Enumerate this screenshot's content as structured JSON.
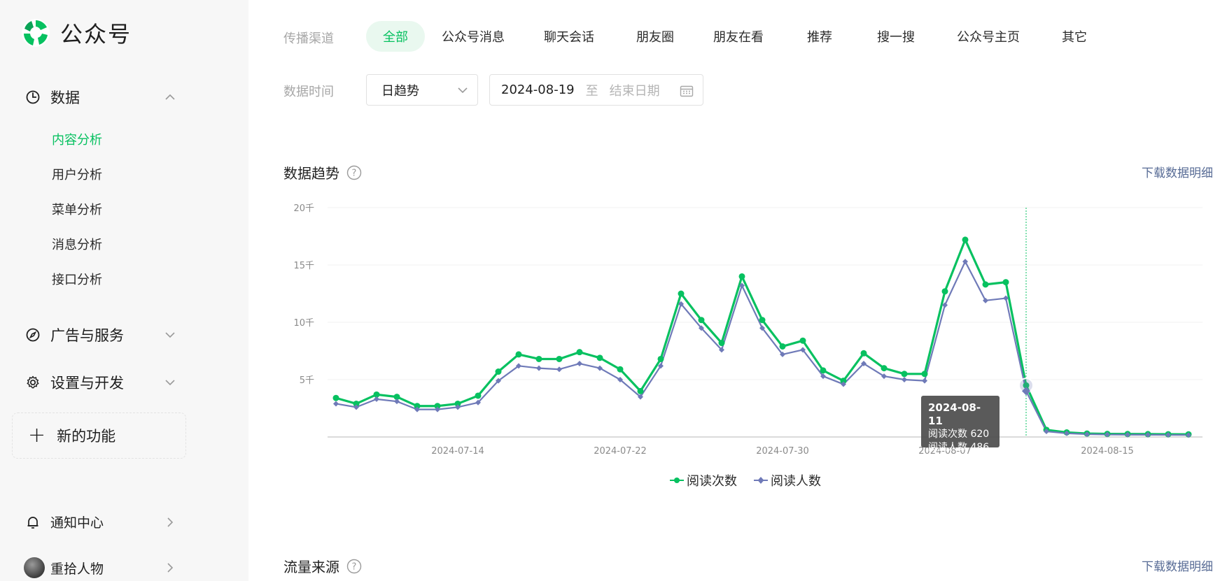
{
  "app": {
    "title": "公众号",
    "logo_icon": "wechat-official-account-logo-icon"
  },
  "sidebar": {
    "data_section": {
      "label": "数据",
      "icon": "pie-chart-icon"
    },
    "data_items": [
      {
        "label": "内容分析",
        "active": true
      },
      {
        "label": "用户分析",
        "active": false
      },
      {
        "label": "菜单分析",
        "active": false
      },
      {
        "label": "消息分析",
        "active": false
      },
      {
        "label": "接口分析",
        "active": false
      }
    ],
    "ads_section": {
      "label": "广告与服务",
      "icon": "compass-icon"
    },
    "settings_section": {
      "label": "设置与开发",
      "icon": "gear-icon"
    },
    "new_feature": {
      "label": "新的功能",
      "icon": "plus-icon"
    },
    "notification": {
      "label": "通知中心",
      "icon": "bell-icon"
    },
    "account": {
      "label": "重拾人物"
    }
  },
  "filters": {
    "channel_label": "传播渠道",
    "channels": [
      "全部",
      "公众号消息",
      "聊天会话",
      "朋友圈",
      "朋友在看",
      "推荐",
      "搜一搜",
      "公众号主页",
      "其它"
    ],
    "active_channel": "全部",
    "time_label": "数据时间",
    "trend_select": "日趋势",
    "start_date": "2024-08-19",
    "range_sep": "至",
    "end_placeholder": "结束日期"
  },
  "trend_section": {
    "title": "数据趋势",
    "download": "下载数据明细"
  },
  "traffic_section": {
    "title": "流量来源",
    "download": "下载数据明细"
  },
  "colors": {
    "accent": "#07c160",
    "series2": "#6f7ab8",
    "link": "#576b95"
  },
  "tooltip": {
    "date": "2024-08-11",
    "line1": "阅读次数 620",
    "line2": "阅读人数 486"
  },
  "chart_data": {
    "type": "line",
    "x_ticks": [
      "2024-07-14",
      "2024-07-22",
      "2024-07-30",
      "2024-08-07",
      "2024-08-15"
    ],
    "y_ticks": [
      "5千",
      "10千",
      "15千",
      "20千"
    ],
    "ylim": [
      0,
      20000
    ],
    "x_start": "2024-07-08",
    "x_end": "2024-08-19",
    "series": [
      {
        "name": "阅读次数",
        "color": "#07c160",
        "marker": "circle",
        "values": [
          3400,
          2900,
          3700,
          3500,
          2700,
          2700,
          2900,
          3600,
          5700,
          7200,
          6800,
          6800,
          7400,
          6900,
          5900,
          4000,
          6800,
          12500,
          10200,
          8200,
          14000,
          10200,
          7900,
          8400,
          5800,
          4900,
          7300,
          6000,
          5500,
          5500,
          12700,
          17200,
          13300,
          13500,
          4500,
          620,
          400,
          300,
          270,
          260,
          250,
          240,
          230
        ]
      },
      {
        "name": "阅读人数",
        "color": "#6f7ab8",
        "marker": "diamond",
        "values": [
          2900,
          2600,
          3300,
          3100,
          2400,
          2400,
          2600,
          3000,
          4900,
          6200,
          6000,
          5900,
          6400,
          6000,
          5000,
          3500,
          6200,
          11600,
          9500,
          7600,
          13200,
          9500,
          7200,
          7600,
          5300,
          4600,
          6400,
          5300,
          5000,
          4900,
          11500,
          15300,
          11900,
          12100,
          4000,
          486,
          320,
          240,
          210,
          200,
          190,
          180,
          170
        ]
      }
    ],
    "legend": "bottom-center",
    "grid": true
  }
}
